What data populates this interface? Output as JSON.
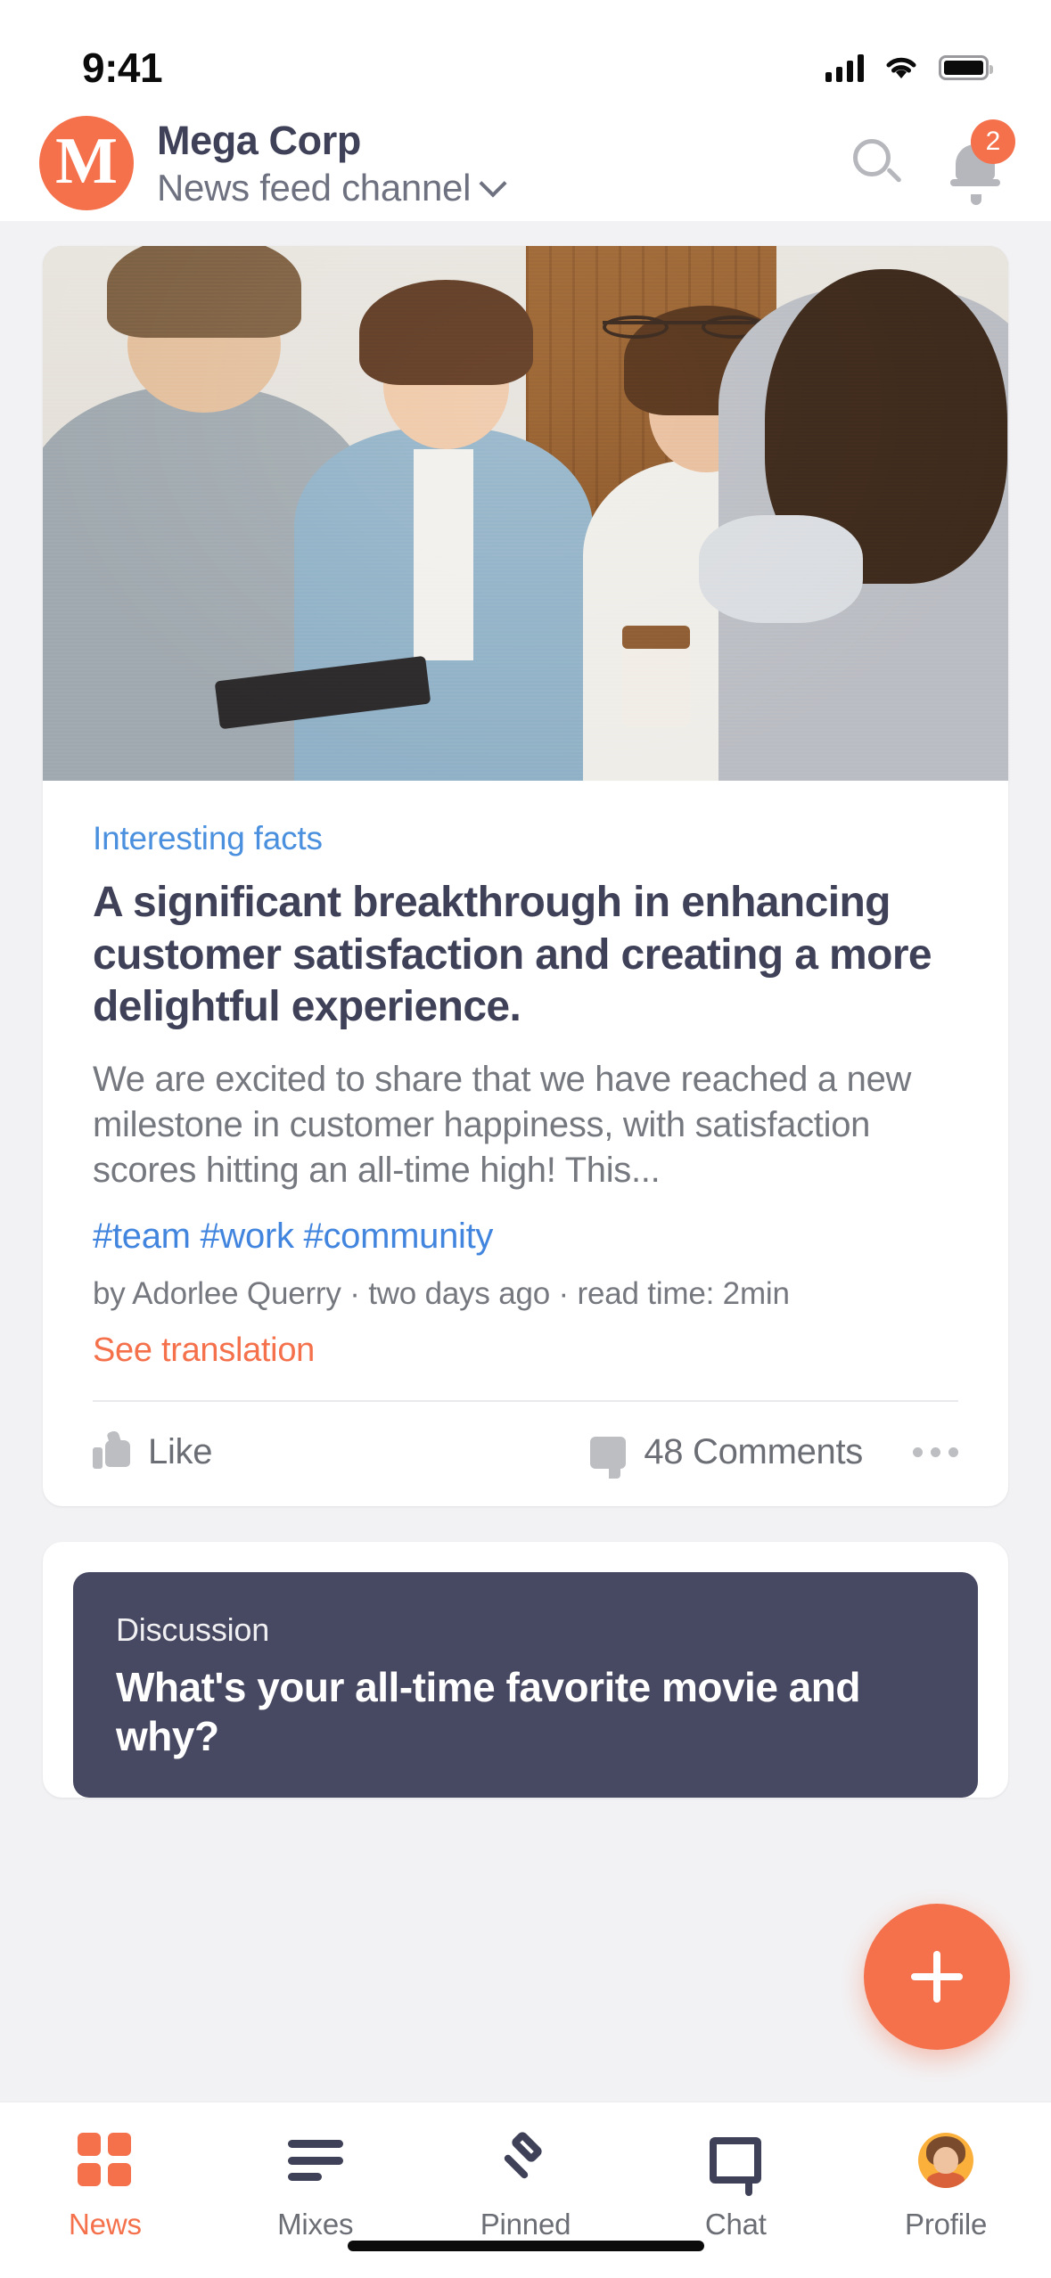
{
  "status_bar": {
    "time": "9:41",
    "signal_icon": "cellular-signal-icon",
    "wifi_icon": "wifi-icon",
    "battery_icon": "battery-icon"
  },
  "header": {
    "logo_letter": "M",
    "brand": "Mega Corp",
    "channel": "News feed channel",
    "chevron_icon": "chevron-down-icon",
    "search_icon": "search-icon",
    "bell_icon": "bell-icon",
    "notification_count": "2"
  },
  "article": {
    "category": "Interesting facts",
    "headline": "A significant breakthrough in enhancing customer satisfaction and creating a more delightful experience.",
    "excerpt": "We are excited to share that we have reached a new milestone in customer happiness, with satisfaction scores hitting an all-time high! This...",
    "tags": "#team #work #community",
    "meta": "by Adorlee Querry · two days ago · read time: 2min",
    "translation_link": "See translation",
    "like_label": "Like",
    "like_icon": "thumbs-up-icon",
    "comments_label": "48 Comments",
    "comments_icon": "comment-bubble-icon",
    "more_icon": "more-options-icon"
  },
  "discussion": {
    "label": "Discussion",
    "question": "What's your all-time favorite movie and why?"
  },
  "fab": {
    "icon": "plus-icon",
    "label": "+"
  },
  "bottom_nav": {
    "items": [
      {
        "label": "News",
        "icon": "grid-icon",
        "active": true
      },
      {
        "label": "Mixes",
        "icon": "lines-icon",
        "active": false
      },
      {
        "label": "Pinned",
        "icon": "pin-icon",
        "active": false
      },
      {
        "label": "Chat",
        "icon": "chat-icon",
        "active": false
      },
      {
        "label": "Profile",
        "icon": "avatar-icon",
        "active": false
      }
    ]
  },
  "colors": {
    "accent": "#F4714C",
    "dark": "#3F4159",
    "discussion_bg": "#474861",
    "link_blue": "#4285DE",
    "muted": "#76787F",
    "avatar_bg": "#FBB03B"
  }
}
